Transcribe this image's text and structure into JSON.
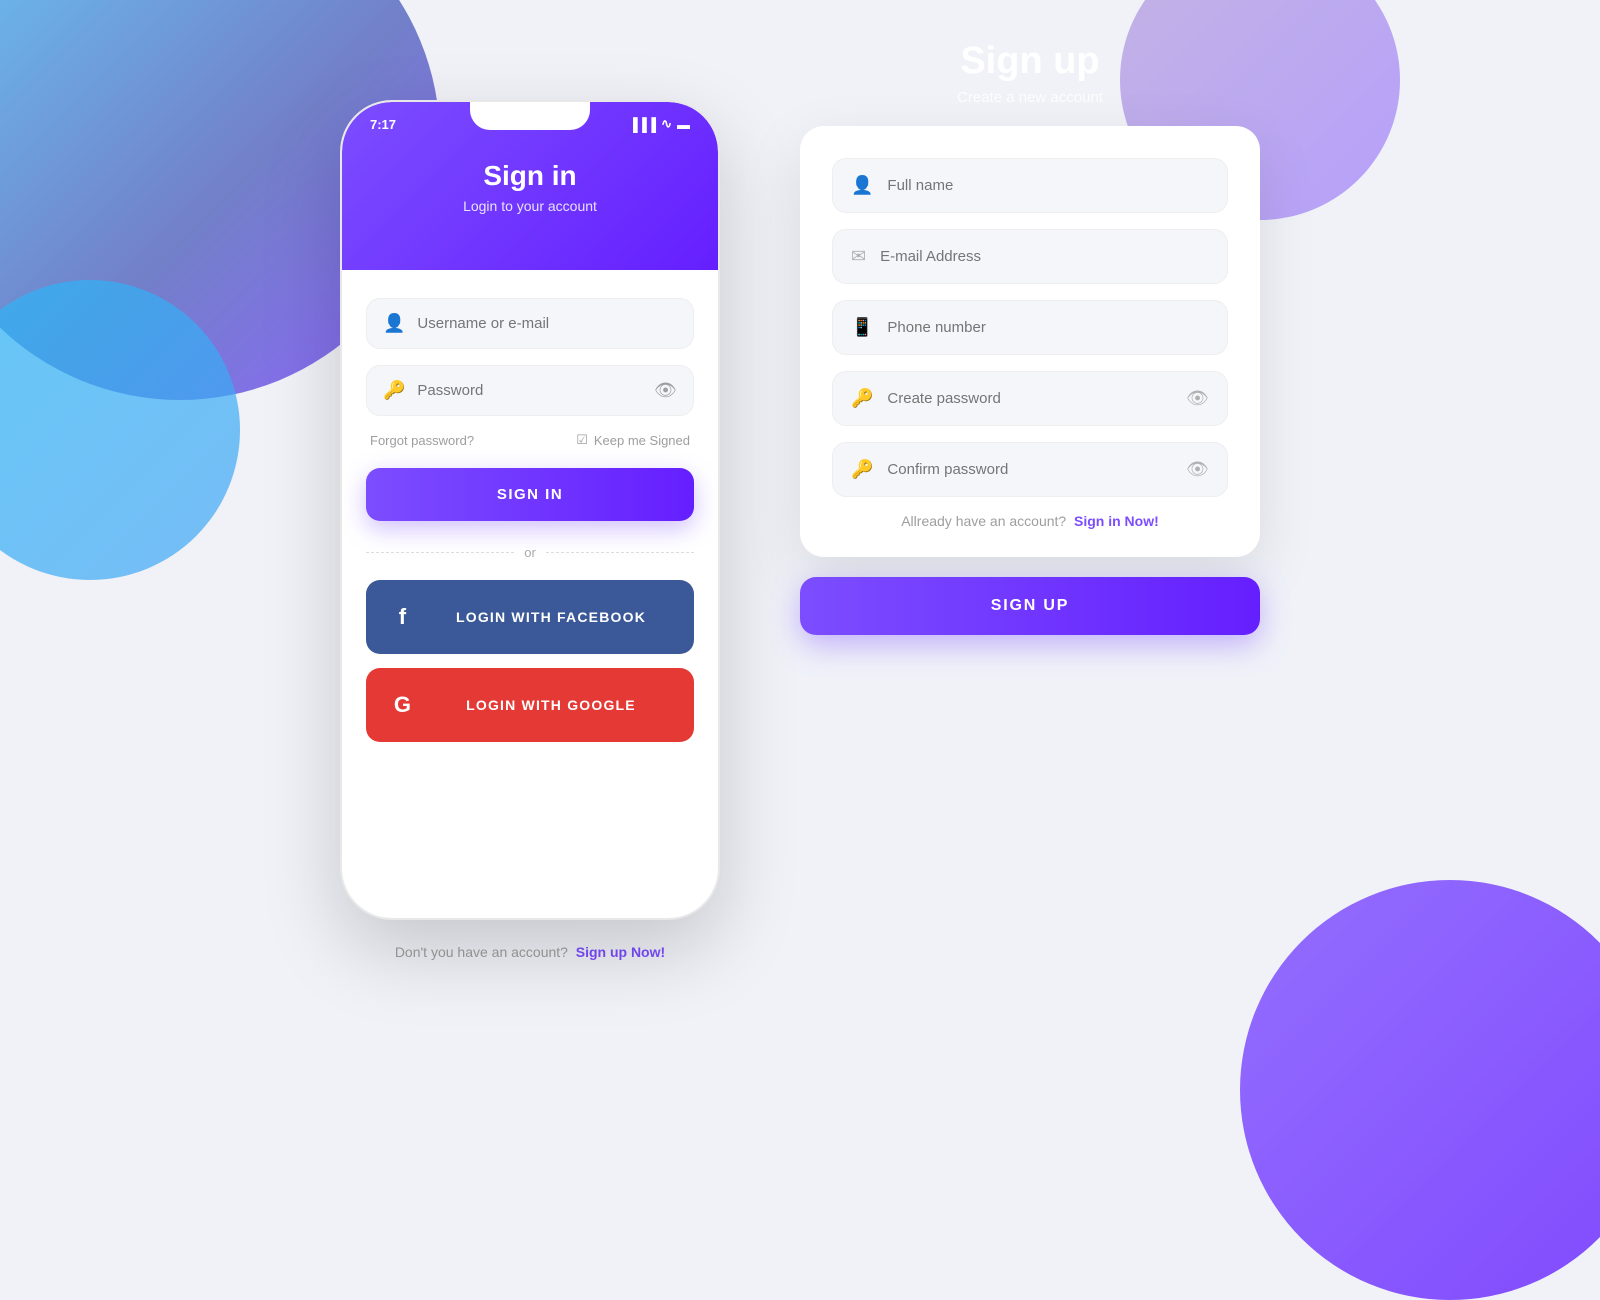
{
  "background": {
    "color": "#f0f2f8"
  },
  "left_panel": {
    "phone": {
      "status_bar": {
        "time": "7:17",
        "signal_icon": "▐▐▐",
        "wifi_icon": "◉",
        "battery_icon": "▬"
      },
      "header": {
        "title": "Sign in",
        "subtitle": "Login to your account"
      },
      "form": {
        "username_placeholder": "Username or e-mail",
        "password_placeholder": "Password",
        "forgot_label": "Forgot password?",
        "keep_signed_label": "Keep me Signed"
      },
      "buttons": {
        "sign_in": "SIGN IN",
        "divider_or": "or",
        "facebook": "LOGIN WITH FACEBOOK",
        "google": "LOGIN WITH GOOGLE"
      },
      "bottom": {
        "text": "Don't you have an account?",
        "link": "Sign up Now!"
      }
    }
  },
  "right_panel": {
    "header": {
      "title": "Sign up",
      "subtitle": "Create a new account"
    },
    "form": {
      "full_name_placeholder": "Full name",
      "email_placeholder": "E-mail Address",
      "phone_placeholder": "Phone number",
      "create_password_placeholder": "Create password",
      "confirm_password_placeholder": "Confirm password"
    },
    "already_account": {
      "text": "Allready have an account?",
      "link": "Sign in Now!"
    },
    "button": {
      "sign_up": "SIGN UP"
    }
  },
  "colors": {
    "purple": "#7c4dff",
    "purple_dark": "#651fff",
    "facebook_blue": "#3b5998",
    "google_red": "#e53935",
    "text_muted": "#9e9e9e",
    "input_bg": "#f5f6fa"
  }
}
